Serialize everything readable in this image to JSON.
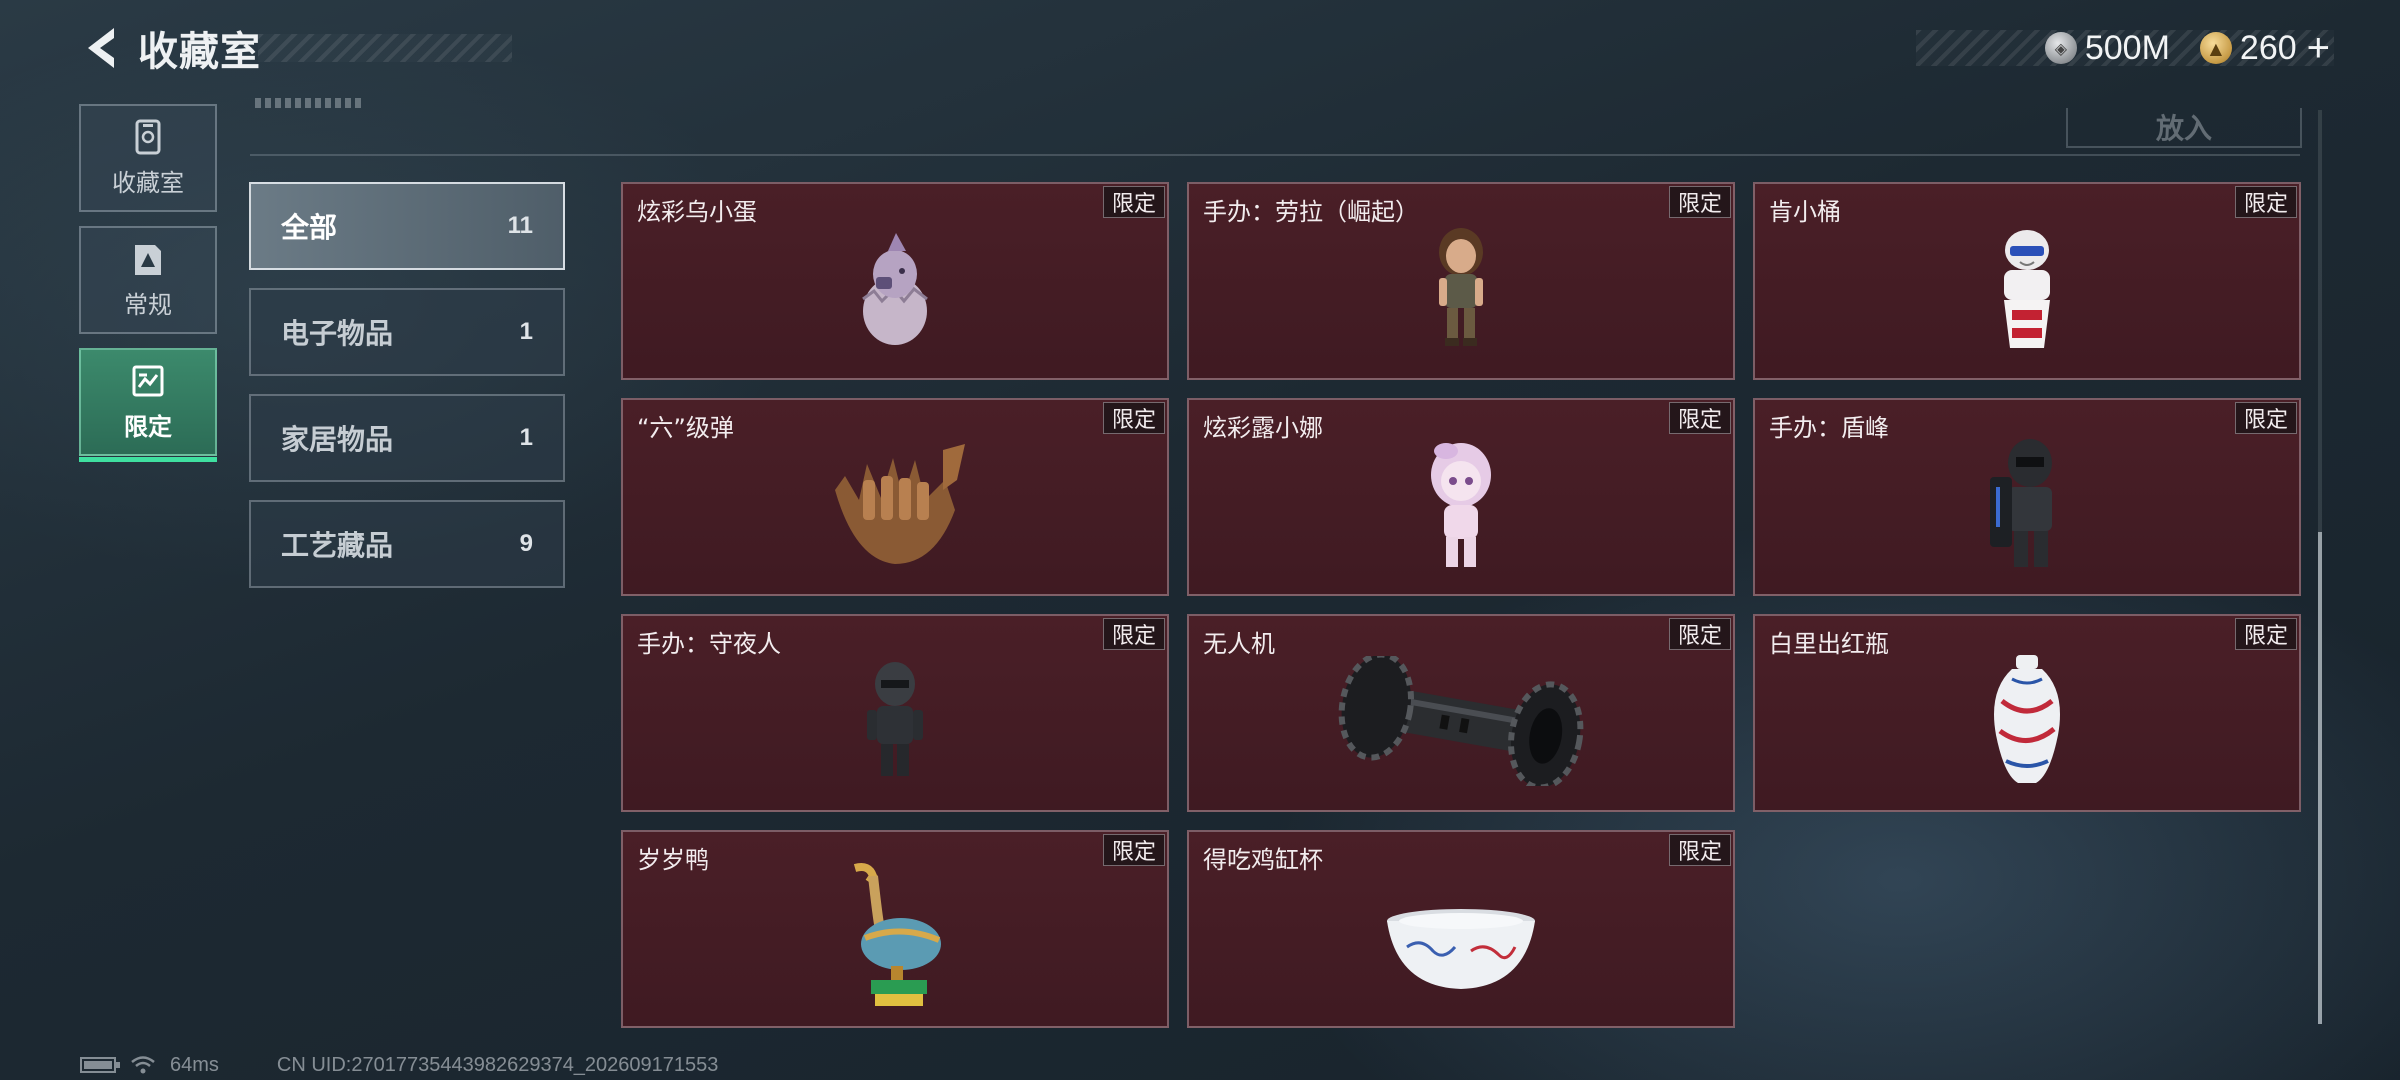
{
  "header": {
    "title": "收藏室",
    "back_icon": "back-arrow-icon",
    "currencies": [
      {
        "icon": "silver-coin-icon",
        "value": "500M",
        "color": "#a9adb1"
      },
      {
        "icon": "gold-coin-icon",
        "value": "260",
        "color": "#d2a655"
      }
    ],
    "plus_label": "+"
  },
  "sidebar": {
    "items": [
      {
        "label": "收藏室",
        "icon": "vault-icon",
        "active": false
      },
      {
        "label": "常规",
        "icon": "card-icon",
        "active": false
      },
      {
        "label": "限定",
        "icon": "limited-icon",
        "active": true
      }
    ],
    "active_color": "#3fe0a0"
  },
  "toolbar": {
    "put_label": "放入"
  },
  "filters": [
    {
      "label": "全部",
      "count": "11",
      "active": true
    },
    {
      "label": "电子物品",
      "count": "1",
      "active": false
    },
    {
      "label": "家居物品",
      "count": "1",
      "active": false
    },
    {
      "label": "工艺藏品",
      "count": "9",
      "active": false
    }
  ],
  "items": [
    {
      "name": "炫彩乌小蛋",
      "tag": "限定",
      "icon": "egg-creature-figure"
    },
    {
      "name": "手办：劳拉（崛起）",
      "tag": "限定",
      "icon": "explorer-figure"
    },
    {
      "name": "肯小桶",
      "tag": "限定",
      "icon": "bucket-chef-figure"
    },
    {
      "name": "“六”级弹",
      "tag": "限定",
      "icon": "bullet-hand-sculpture"
    },
    {
      "name": "炫彩露小娜",
      "tag": "限定",
      "icon": "pink-girl-figure"
    },
    {
      "name": "手办：盾峰",
      "tag": "限定",
      "icon": "shield-soldier-figure"
    },
    {
      "name": "手办：守夜人",
      "tag": "限定",
      "icon": "night-watcher-figure"
    },
    {
      "name": "无人机",
      "tag": "限定",
      "icon": "drone-roller"
    },
    {
      "name": "白里出红瓶",
      "tag": "限定",
      "icon": "porcelain-vase"
    },
    {
      "name": "岁岁鸭",
      "tag": "限定",
      "icon": "duck-statue"
    },
    {
      "name": "得吃鸡缸杯",
      "tag": "限定",
      "icon": "porcelain-cup"
    }
  ],
  "card_color": "#4a1f27",
  "footer": {
    "ping": "64ms",
    "uid": "CN UID:27017735443982629374_202609171553"
  }
}
